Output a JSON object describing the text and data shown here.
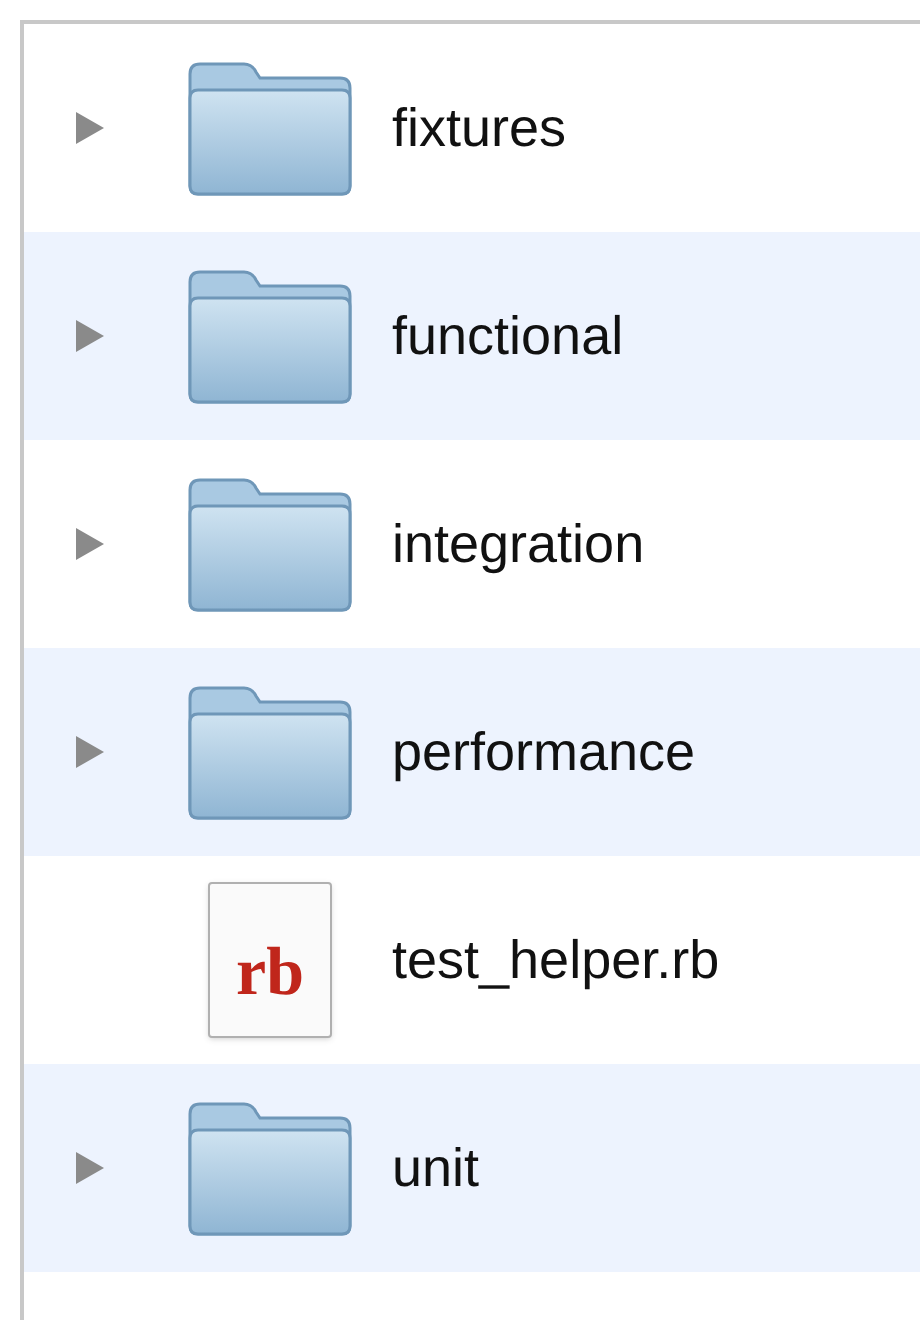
{
  "items": [
    {
      "kind": "folder",
      "name": "fixtures",
      "expanded": false
    },
    {
      "kind": "folder",
      "name": "functional",
      "expanded": false
    },
    {
      "kind": "folder",
      "name": "integration",
      "expanded": false
    },
    {
      "kind": "folder",
      "name": "performance",
      "expanded": false
    },
    {
      "kind": "file",
      "name": "test_helper.rb",
      "icon_label": "rb"
    },
    {
      "kind": "folder",
      "name": "unit",
      "expanded": false
    }
  ]
}
